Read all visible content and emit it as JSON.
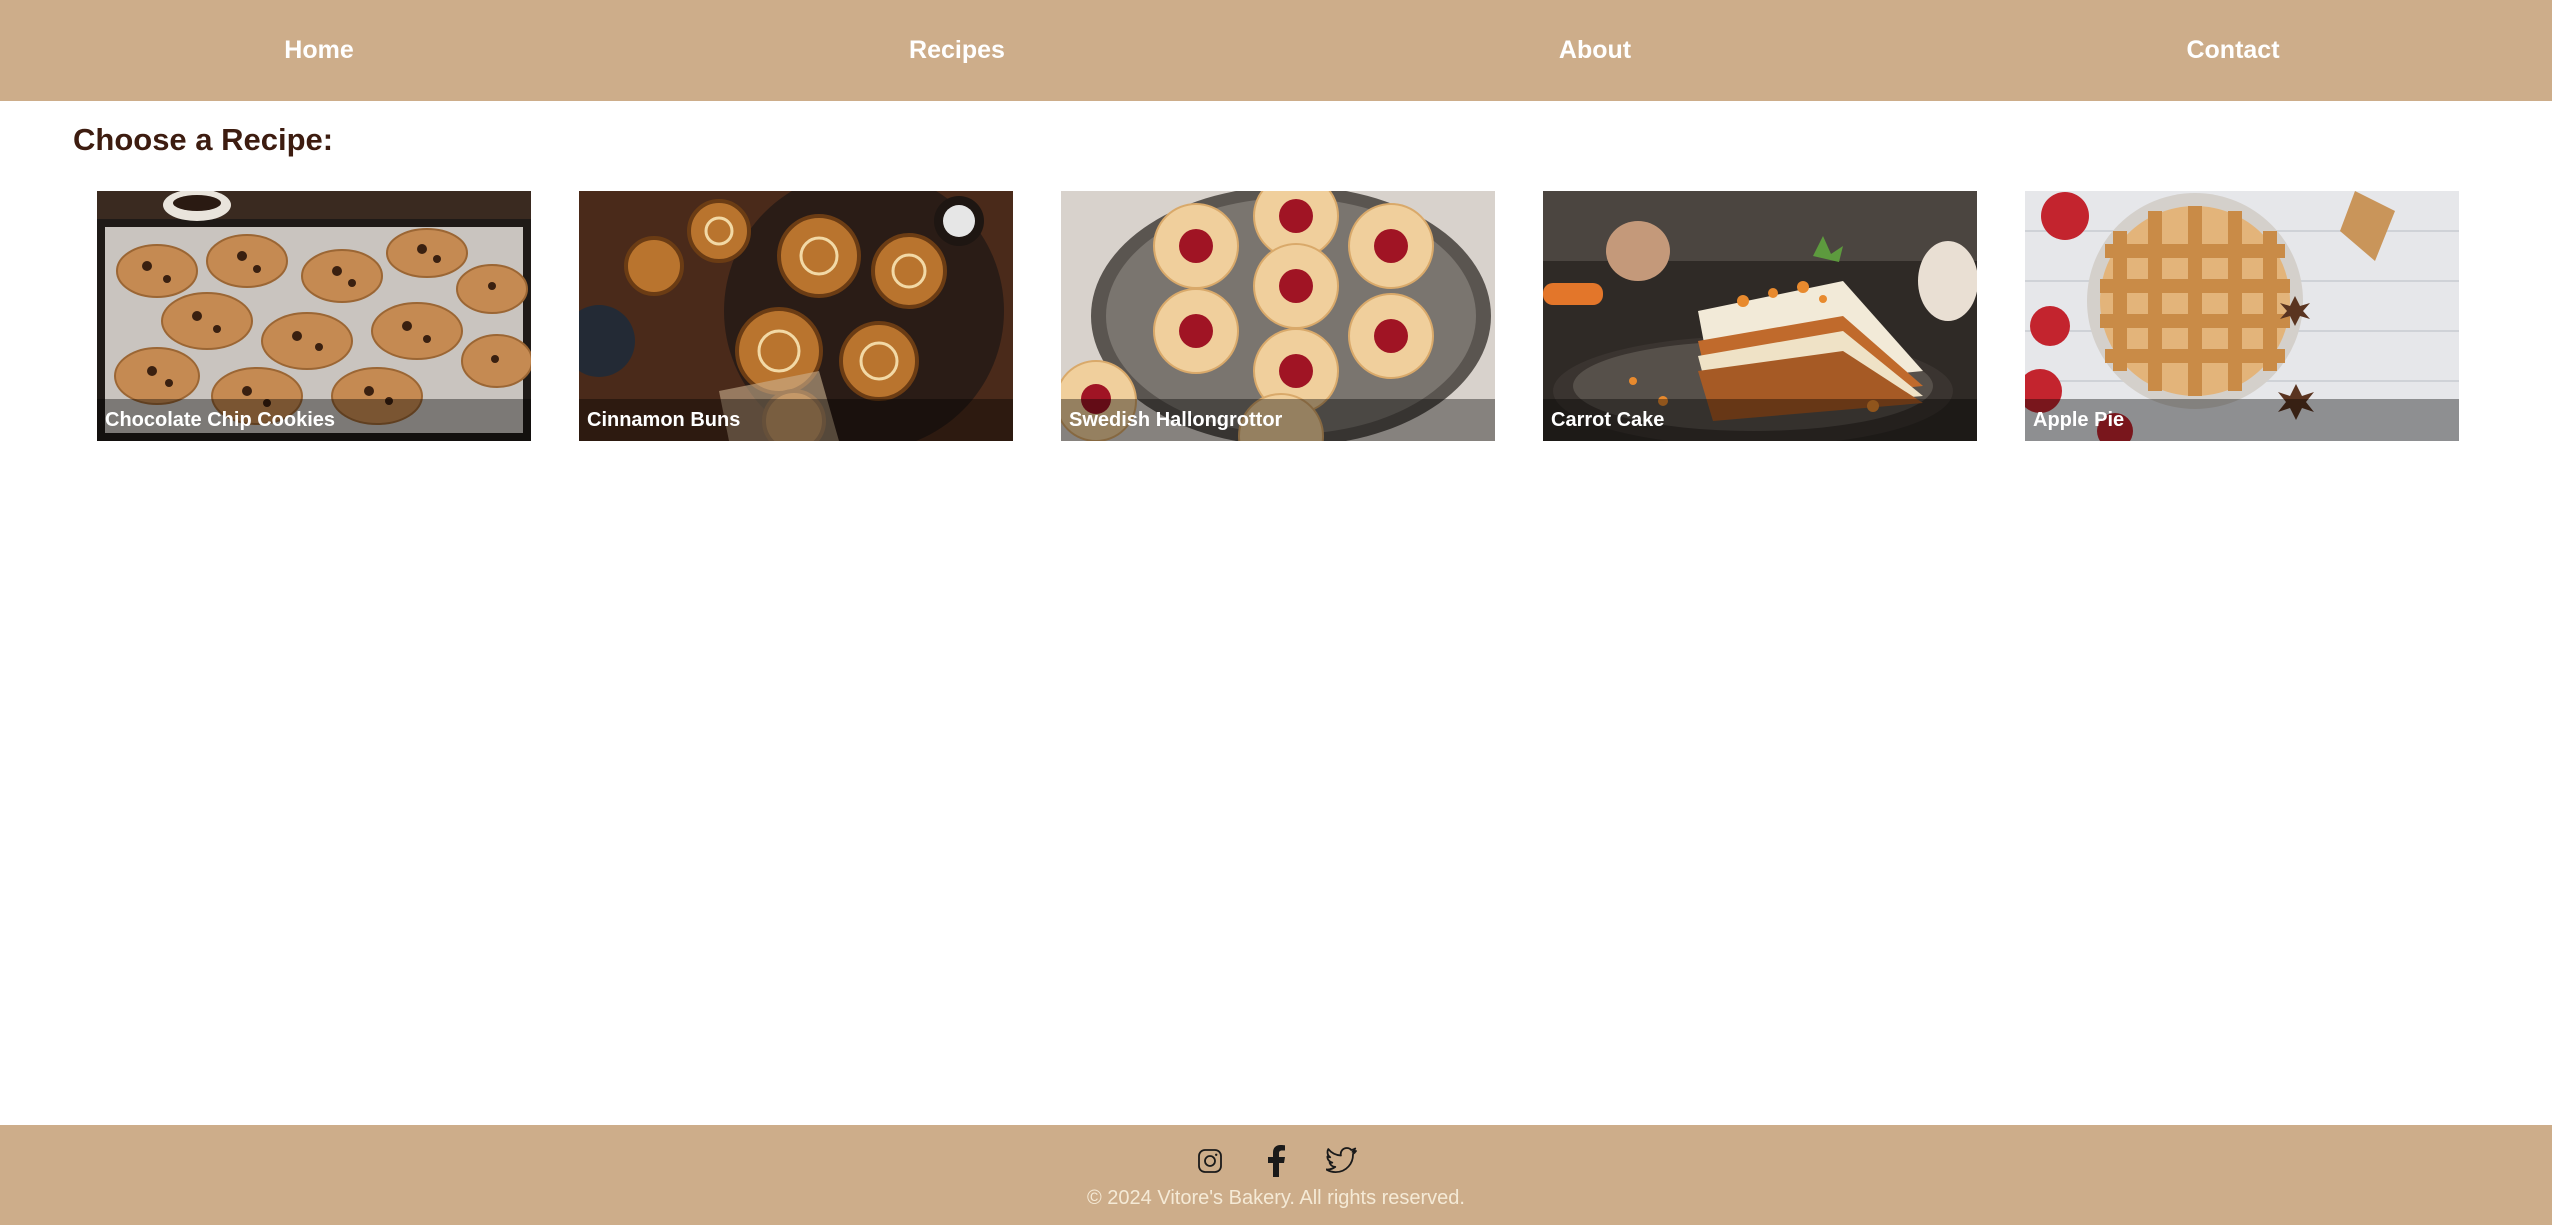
{
  "nav": {
    "items": [
      {
        "label": "Home"
      },
      {
        "label": "Recipes"
      },
      {
        "label": "About"
      },
      {
        "label": "Contact"
      }
    ]
  },
  "main": {
    "heading": "Choose a Recipe:",
    "recipes": [
      {
        "title": "Chocolate Chip Cookies"
      },
      {
        "title": "Cinnamon Buns"
      },
      {
        "title": "Swedish Hallongrottor"
      },
      {
        "title": "Carrot Cake"
      },
      {
        "title": "Apple Pie"
      }
    ]
  },
  "footer": {
    "social": [
      "instagram-icon",
      "facebook-icon",
      "twitter-icon"
    ],
    "copyright": "© 2024 Vitore's Bakery. All rights reserved."
  },
  "colors": {
    "nav_bg": "#cdad8a",
    "footer_bg": "#cdad8a",
    "heading": "#3d1c10",
    "copyright": "#f5ead6"
  }
}
